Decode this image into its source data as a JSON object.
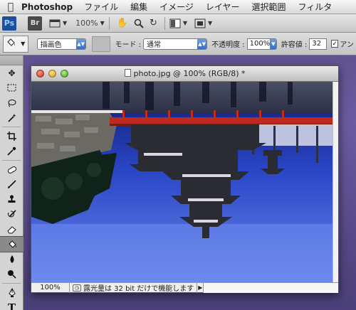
{
  "menubar": {
    "apple_icon": "apple-icon",
    "app_name": "Photoshop",
    "menus": [
      "ファイル",
      "編集",
      "イメージ",
      "レイヤー",
      "選択範囲",
      "フィルタ"
    ]
  },
  "appbar": {
    "ps_label": "Ps",
    "br_label": "Br",
    "zoom": "100%",
    "icons": [
      "view-extras-icon",
      "hand-icon",
      "zoom-icon",
      "rotate-view-icon",
      "arrange-documents-icon",
      "screen-mode-icon"
    ]
  },
  "options": {
    "tool_icon": "paint-bucket-icon",
    "fill_source": "描画色",
    "mode_label": "モード :",
    "mode_value": "通常",
    "opacity_label": "不透明度 :",
    "opacity_value": "100%",
    "tolerance_label": "許容値 :",
    "tolerance_value": "32",
    "antialias_label": "アン",
    "antialias_checked": true
  },
  "tools": [
    "move-icon",
    "marquee-icon",
    "lasso-icon",
    "magic-wand-icon",
    "crop-icon",
    "eyedropper-icon",
    "healing-brush-icon",
    "brush-icon",
    "clone-stamp-icon",
    "history-brush-icon",
    "eraser-icon",
    "paint-bucket-icon",
    "blur-icon",
    "dodge-icon",
    "pen-icon",
    "type-icon"
  ],
  "document": {
    "title": "photo.jpg @ 100% (RGB/8) *",
    "zoom": "100%",
    "status": "露光量は 32 bit だけで機能します"
  },
  "colors": {
    "sky_top": "#0f1a6a",
    "sky_bottom": "#6a86e8",
    "bridge_red": "#c02a1c",
    "active_tool_bg": "#8a8a8a"
  }
}
